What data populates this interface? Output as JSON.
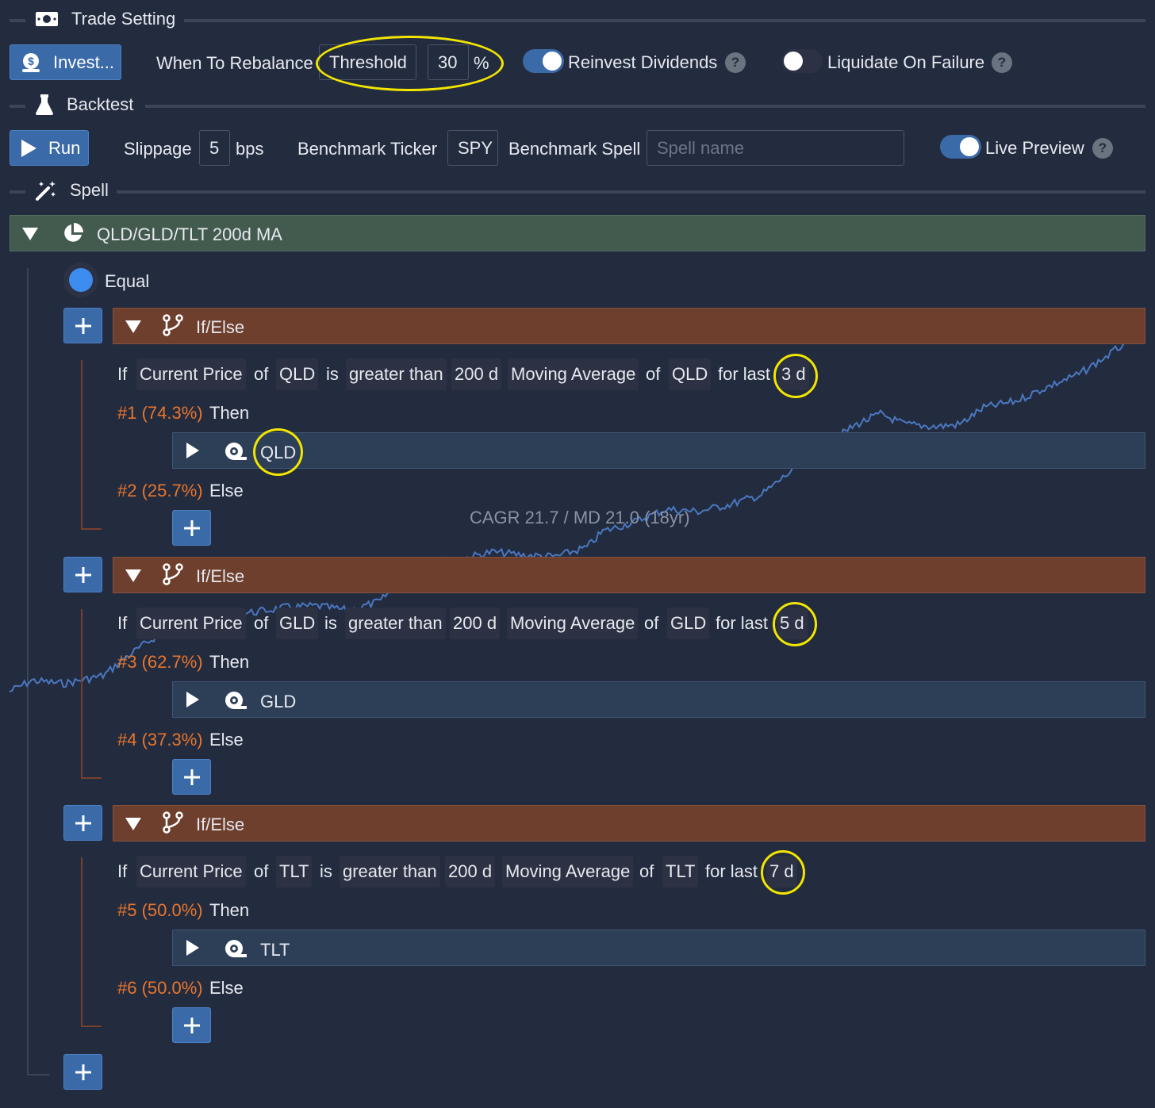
{
  "trade_setting": {
    "title": "Trade Setting",
    "invest_label": "Invest...",
    "when_to_rebalance_label": "When To Rebalance",
    "rebalance_mode": "Threshold",
    "threshold_value": "30",
    "threshold_unit": "%",
    "reinvest_dividends_label": "Reinvest Dividends",
    "reinvest_dividends_on": true,
    "liquidate_on_failure_label": "Liquidate On Failure",
    "liquidate_on_failure_on": false,
    "help_glyph": "?"
  },
  "backtest": {
    "title": "Backtest",
    "run_label": "Run",
    "slippage_label": "Slippage",
    "slippage_value": "5",
    "slippage_unit": "bps",
    "benchmark_ticker_label": "Benchmark Ticker",
    "benchmark_ticker_value": "SPY",
    "benchmark_spell_label": "Benchmark Spell",
    "benchmark_spell_placeholder": "Spell name",
    "live_preview_label": "Live Preview",
    "live_preview_on": true
  },
  "spell": {
    "title": "Spell",
    "root_name": "QLD/GLD/TLT 200d MA",
    "weighting": "Equal",
    "blocks": [
      {
        "header": "If/Else",
        "cond": {
          "if": "If",
          "metric": "Current Price",
          "of1": "of",
          "ticker1": "QLD",
          "is": "is",
          "op": "greater than",
          "window": "200",
          "window_unit": "d",
          "indicator": "Moving Average",
          "of2": "of",
          "ticker2": "QLD",
          "for_last": "for last",
          "days": "3",
          "days_unit": "d"
        },
        "then_tag": "#1 (74.3%)",
        "then_label": "Then",
        "then_ticker": "QLD",
        "else_tag": "#2 (25.7%)",
        "else_label": "Else"
      },
      {
        "header": "If/Else",
        "cond": {
          "if": "If",
          "metric": "Current Price",
          "of1": "of",
          "ticker1": "GLD",
          "is": "is",
          "op": "greater than",
          "window": "200",
          "window_unit": "d",
          "indicator": "Moving Average",
          "of2": "of",
          "ticker2": "GLD",
          "for_last": "for last",
          "days": "5",
          "days_unit": "d"
        },
        "then_tag": "#3 (62.7%)",
        "then_label": "Then",
        "then_ticker": "GLD",
        "else_tag": "#4 (37.3%)",
        "else_label": "Else"
      },
      {
        "header": "If/Else",
        "cond": {
          "if": "If",
          "metric": "Current Price",
          "of1": "of",
          "ticker1": "TLT",
          "is": "is",
          "op": "greater than",
          "window": "200",
          "window_unit": "d",
          "indicator": "Moving Average",
          "of2": "of",
          "ticker2": "TLT",
          "for_last": "for last",
          "days": "7",
          "days_unit": "d"
        },
        "then_tag": "#5 (50.0%)",
        "then_label": "Then",
        "then_ticker": "TLT",
        "else_tag": "#6 (50.0%)",
        "else_label": "Else"
      }
    ]
  },
  "preview_chart": {
    "summary": "CAGR 21.7 / MD 21.0 (18yr)",
    "line_color": "#4a78c0"
  },
  "colors": {
    "background": "#232b3f",
    "accent_blue": "#3a6aa8",
    "ifelse_header": "#6f3f2e",
    "root_header": "#435a4f",
    "asset_row": "#2d3f57",
    "weight_orange": "#e8762c",
    "highlight_yellow": "#f2e600"
  },
  "icons": {
    "trade_setting": "money-icon",
    "invest": "money-bag-icon",
    "backtest": "flask-icon",
    "run": "play-icon",
    "spell": "magic-wand-icon",
    "root": "pie-chart-icon",
    "ifelse": "branch-icon",
    "asset": "ticker-icon",
    "add": "plus-icon"
  }
}
